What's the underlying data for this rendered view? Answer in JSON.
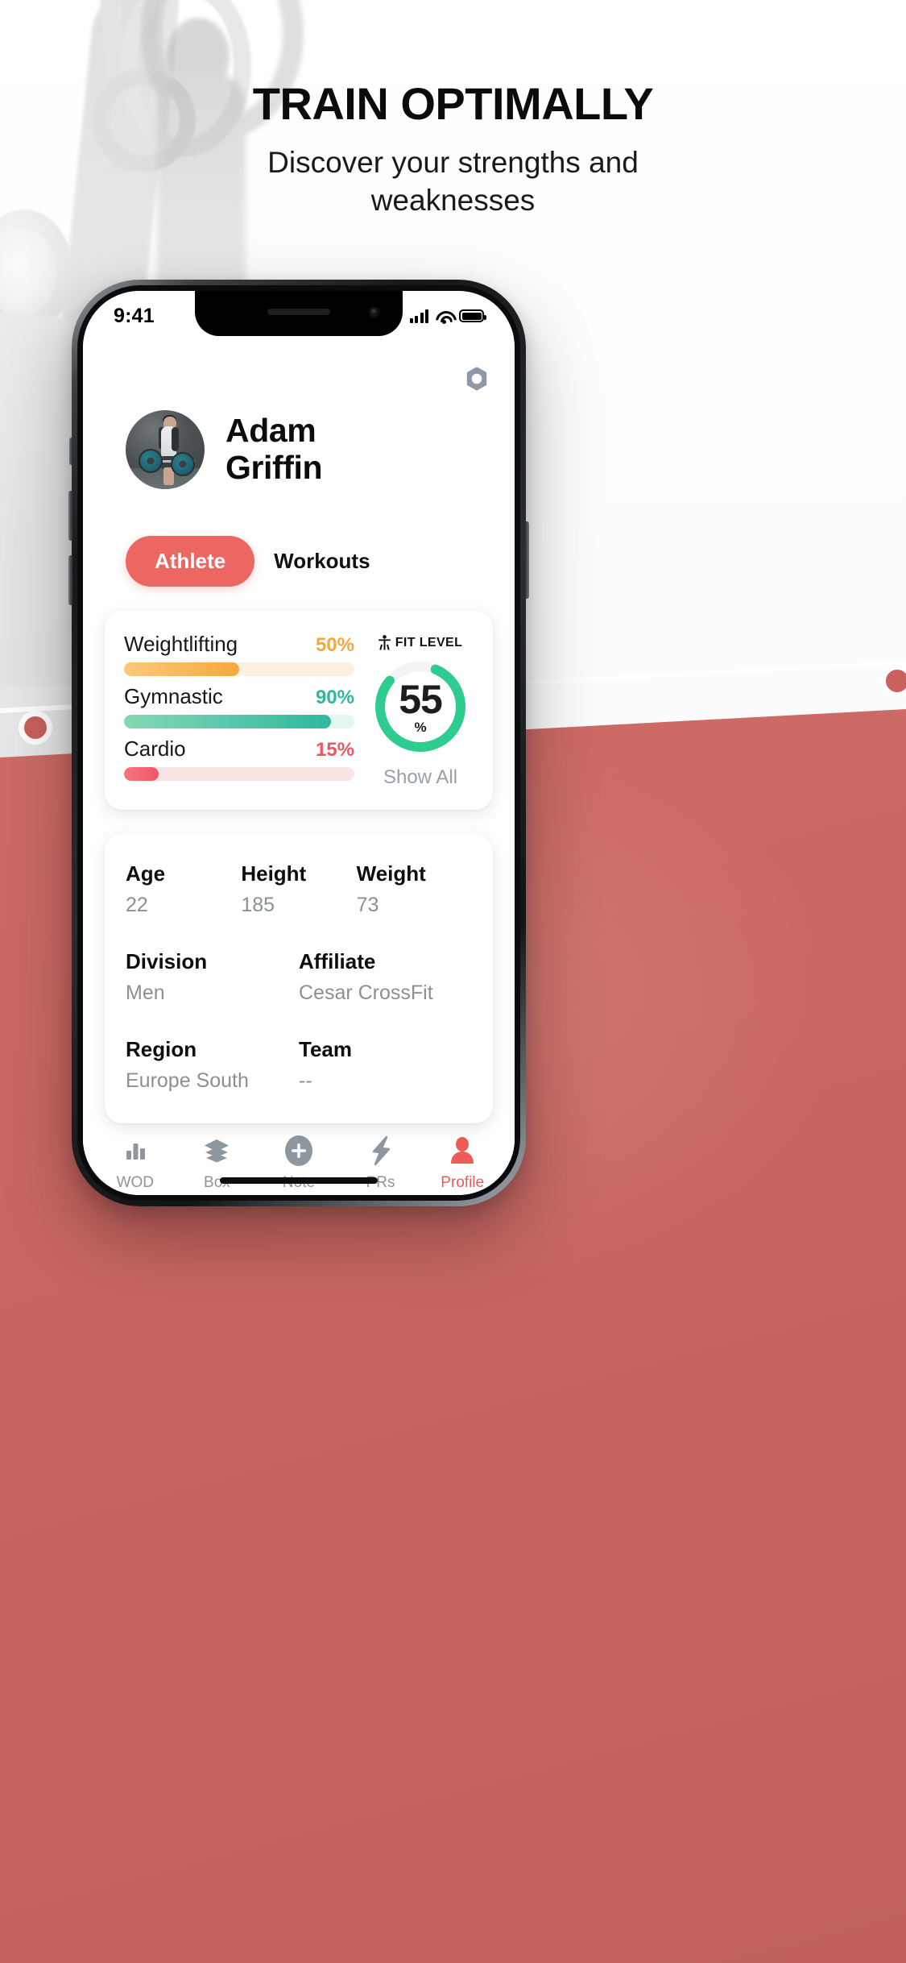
{
  "page": {
    "headline": "TRAIN OPTIMALLY",
    "subhead_line1": "Discover your strengths and",
    "subhead_line2": "weaknesses",
    "accent_color": "#ec6762",
    "background_bottom_color": "#cf6b66"
  },
  "status_bar": {
    "time": "9:41",
    "cellular_icon": "signal-bars-icon",
    "wifi_icon": "wifi-icon",
    "battery_icon": "battery-full-icon"
  },
  "app": {
    "settings_icon": "hex-nut-settings-icon",
    "profile": {
      "name_line1": "Adam",
      "name_line2": "Griffin",
      "avatar_alt": "athlete-avatar"
    },
    "tabs": [
      {
        "label": "Athlete",
        "active": true
      },
      {
        "label": "Workouts",
        "active": false
      }
    ],
    "skills": [
      {
        "name": "Weightlifting",
        "value": "50%",
        "pct": 50,
        "color": "#f5a83c",
        "color_from": "#fbc97b",
        "track": "#fdf0e0"
      },
      {
        "name": "Gymnastic",
        "value": "90%",
        "pct": 90,
        "color": "#2fb89d",
        "color_from": "#85d8b6",
        "track": "#e4f6ee"
      },
      {
        "name": "Cardio",
        "value": "15%",
        "pct": 15,
        "color": "#ef5663",
        "color_from": "#f4777f",
        "track": "#fbe4e6"
      }
    ],
    "fit_level": {
      "icon": "person-accessibility-icon",
      "title": "FIT LEVEL",
      "value": "55",
      "unit": "%",
      "pct": 55,
      "ring_color": "#2ecc8f",
      "track_color": "#f1f3f4",
      "show_all_label": "Show All"
    },
    "stats": {
      "row1": [
        {
          "label": "Age",
          "value": "22"
        },
        {
          "label": "Height",
          "value": "185"
        },
        {
          "label": "Weight",
          "value": "73"
        }
      ],
      "row2": [
        {
          "label": "Division",
          "value": "Men"
        },
        {
          "label": "Affiliate",
          "value": "Cesar CrossFit"
        }
      ],
      "row3": [
        {
          "label": "Region",
          "value": "Europe South"
        },
        {
          "label": "Team",
          "value": "--"
        }
      ]
    },
    "bottom_nav": [
      {
        "label": "WOD",
        "icon": "bar-chart-icon",
        "active": false
      },
      {
        "label": "Box",
        "icon": "layers-icon",
        "active": false
      },
      {
        "label": "Note",
        "icon": "plus-circle-icon",
        "active": false
      },
      {
        "label": "PRs",
        "icon": "lightning-bolt-icon",
        "active": false
      },
      {
        "label": "Profile",
        "icon": "person-icon",
        "active": true
      }
    ]
  }
}
